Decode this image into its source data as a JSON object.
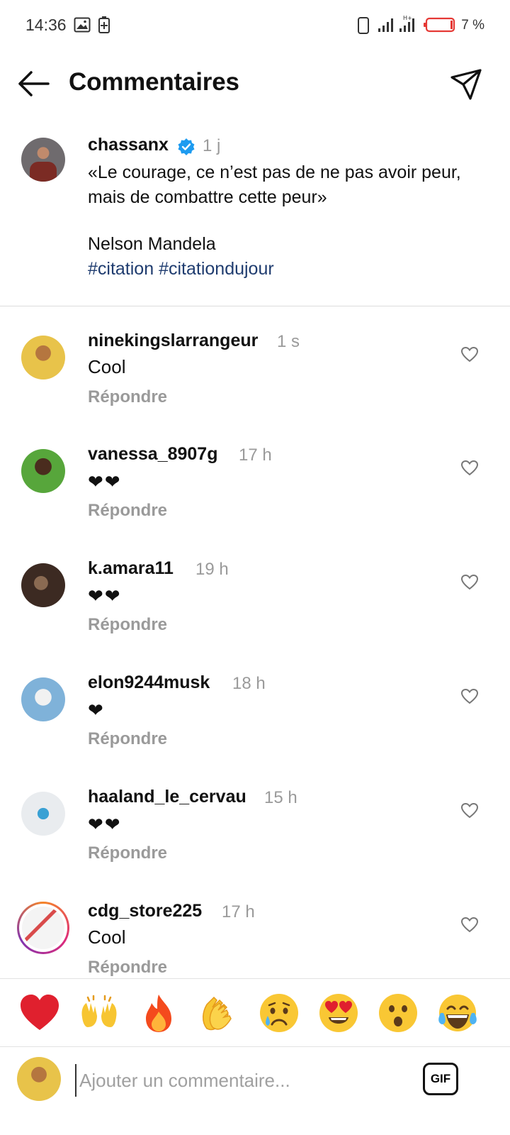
{
  "status_bar": {
    "time": "14:36",
    "battery": "7 %"
  },
  "header": {
    "title": "Commentaires",
    "back_icon": "back-arrow-icon",
    "share_icon": "paper-plane-icon"
  },
  "caption": {
    "username": "chassanx",
    "time": "1 j",
    "text": "«Le courage, ce n’est pas de ne pas avoir peur, mais de combattre cette peur»",
    "author": "Nelson Mandela",
    "hashtags": [
      "#citation",
      "#citationdujour"
    ]
  },
  "reply_label": "Répondre",
  "comments": [
    {
      "username": "ninekingslarrangeur",
      "time": "1 s",
      "text": "Cool"
    },
    {
      "username": "vanessa_8907g",
      "time": "17 h",
      "text": "❤❤"
    },
    {
      "username": "k.amara11",
      "time": "19 h",
      "text": "❤❤"
    },
    {
      "username": "elon9244musk",
      "time": "18 h",
      "text": "❤"
    },
    {
      "username": "haaland_le_cervau",
      "time": "15 h",
      "text": "❤❤"
    },
    {
      "username": "cdg_store225",
      "time": "17 h",
      "text": "Cool"
    }
  ],
  "emoji_bar": [
    "heart",
    "raised-hands",
    "fire",
    "clapping-hands",
    "crying-face",
    "heart-eyes-face",
    "surprised-face",
    "tears-of-joy-face"
  ],
  "input": {
    "placeholder": "Ajouter un commentaire...",
    "gif_label": "GIF"
  },
  "colors": {
    "accent_blue": "#1f3c6f",
    "verified": "#1d9bf0",
    "heart_red": "#e0202e",
    "muted": "#9a9a9a"
  }
}
